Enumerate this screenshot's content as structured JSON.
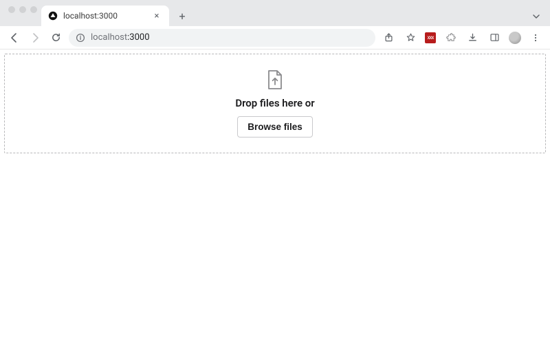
{
  "browser": {
    "tab_title": "localhost:3000",
    "url_display_prefix": "localhost",
    "url_display_suffix": ":3000",
    "new_tab_label": "+",
    "close_tab_label": "×"
  },
  "toolbar_icons": {
    "back": "back-icon",
    "forward": "forward-icon",
    "reload": "reload-icon",
    "info": "info-icon",
    "share": "share-icon",
    "star": "star-icon",
    "extension_red": "xxx",
    "extensions": "puzzle-icon",
    "download": "download-icon",
    "panel": "side-panel-icon",
    "avatar": "avatar-icon",
    "menu": "kebab-icon",
    "window_expand": "chevron-down-icon"
  },
  "dropzone": {
    "prompt": "Drop files here or",
    "button_label": "Browse files"
  }
}
